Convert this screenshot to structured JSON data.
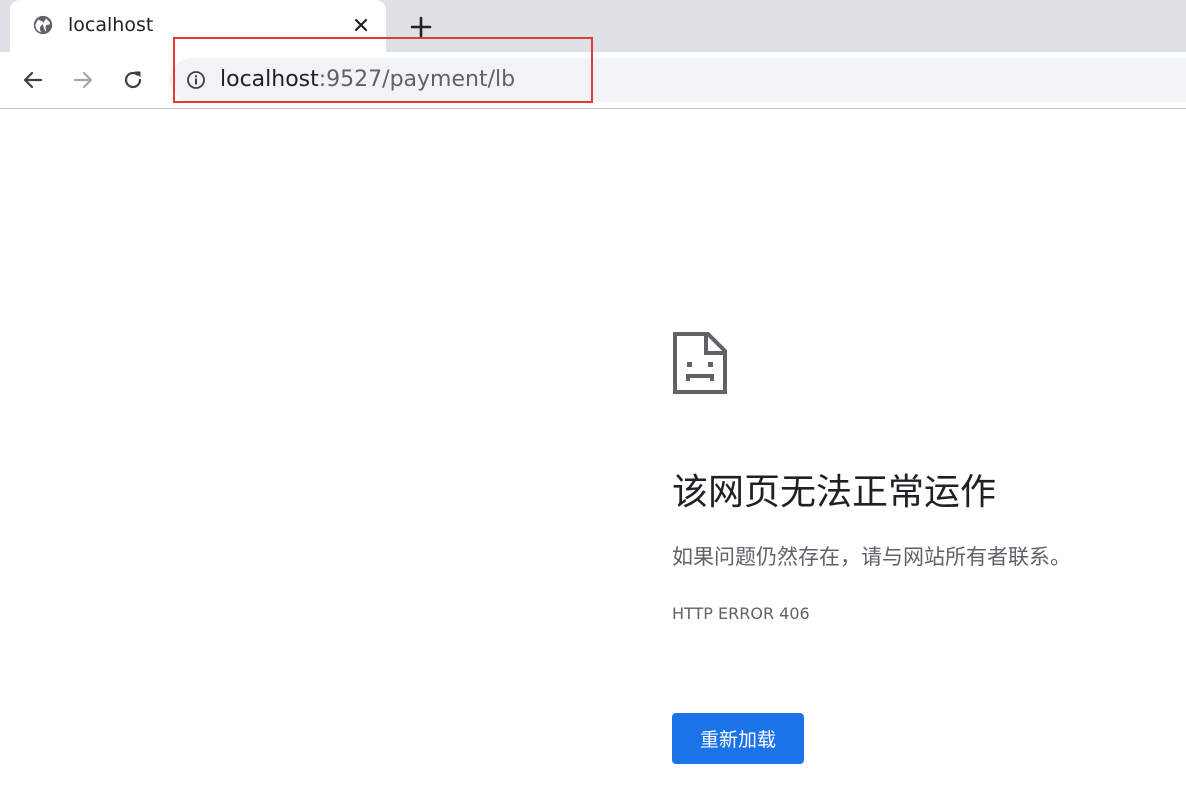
{
  "tab": {
    "title": "localhost",
    "favicon": "globe-icon",
    "close_icon": "close-icon"
  },
  "new_tab_icon": "plus-icon",
  "toolbar": {
    "back_icon": "arrow-left-icon",
    "forward_icon": "arrow-right-icon",
    "reload_icon": "reload-icon"
  },
  "omnibox": {
    "info_icon": "info-icon",
    "url_host": "localhost",
    "url_rest": ":9527/payment/lb"
  },
  "error_page": {
    "icon": "sad-page-icon",
    "title": "该网页无法正常运作",
    "description": "如果问题仍然存在，请与网站所有者联系。",
    "code": "HTTP ERROR 406",
    "reload_label": "重新加载"
  },
  "colors": {
    "tabstrip": "#dee1e6",
    "omnibox": "#f1f3f4",
    "highlight": "#e53935",
    "primary_button": "#1a73e8",
    "text_primary": "#202124",
    "text_secondary": "#5f6368"
  }
}
